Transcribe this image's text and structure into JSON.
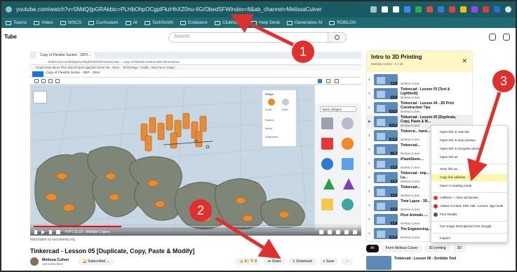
{
  "browser": {
    "url": "youtube.com/watch?v=5MdQ/jpGRAkbtc=PLHbOhpOCgplFkzHhXZ0nu-lIG/ObedSFWindex=8&ab_channel=MelissaCulver",
    "bookmarks": [
      "Teams",
      "Video",
      "WSCS",
      "Curriculum",
      "AI",
      "TechSmith",
      "Endeavor",
      "Clubhouse",
      "Help Desk",
      "Generative AI",
      "ROBLOX"
    ]
  },
  "masthead": {
    "logo": "Tube",
    "search_placeholder": "Search"
  },
  "video": {
    "inner_tab": "Copy of Flexible Socket - 3DPr...",
    "inner_url": "tinkercad.com/things/q-Ft8gFbXk/edit?sharecode=...copy-of-flexible-socket-with-dimensions",
    "inner_bookmarks": "Gmail  Drive  Menu  Plus 3dLCM Quiz  appointr  Home Ink - Nozo...  Technology - Usabl...  Best Hour Usage...",
    "design_title": "Copy of Flexible Socke - 3DP - 2024",
    "panel_title": "Shape",
    "panel_rows": [
      "Solid",
      "Hole",
      "Radius",
      "Bevel",
      "Segments"
    ],
    "category": "Basic Shapes",
    "watermark": "Watchable by wscsfamily.org",
    "time": "3:05 / 11:23 · Multiple Copies",
    "progress": 0.27
  },
  "below": {
    "title": "Tinkercad - Lesson 05 [Duplicate, Copy, Paste & Modify]",
    "channel": "Melissa Culver",
    "subscribers": "116 subscribers",
    "subscribe_label": "Subscribed",
    "likes": "9",
    "dislikes": "0",
    "share": "Share",
    "download": "Download",
    "save": "Save"
  },
  "playlist": {
    "title": "Intro to 3D Printing",
    "subtitle": "Melissa Culver - 6 / 25",
    "items": [
      {
        "title": "",
        "author": "Melissa Culver",
        "duration": "8:47"
      },
      {
        "title": "Tinkercad - Lesson 03 [Text & Lightbulb]",
        "author": "Melissa Culver",
        "duration": "9:12"
      },
      {
        "title": "Tinkercad - Lesson 04 - 3D Print Construction Tips",
        "author": "Melissa Culver",
        "duration": "12:34"
      },
      {
        "title": "Tinkercad - Lesson 05 [Duplicate, Copy, Paste & M...",
        "author": "Melissa Culver",
        "duration": "11:23"
      },
      {
        "title": "Tinkerca... hand...",
        "author": "Melissa Culver",
        "duration": "10:04"
      },
      {
        "title": "Tinkercad...",
        "author": "Melissa Culver",
        "duration": "7:58"
      },
      {
        "title": "iFlaskStone...",
        "author": "Melissa Culver",
        "duration": "6:41"
      },
      {
        "title": "Tinkercad - Imp... Scribble, and La...",
        "author": "Melissa Culver",
        "duration": "9:35"
      },
      {
        "title": "Tinkercad...",
        "author": "Melissa Culver",
        "duration": "5:22"
      },
      {
        "title": "Time Lapse - 3D... Prostitatic",
        "author": "Melissa Culver",
        "duration": "4:10"
      },
      {
        "title": "Flexi Animals -...",
        "author": "Melissa Culver",
        "duration": "3:47"
      },
      {
        "title": "The Engineering... Taco Party",
        "author": "Melissa Culver",
        "duration": "15:02"
      }
    ]
  },
  "chips": [
    "All",
    "From Melissa Culver",
    "3D printing",
    "3D"
  ],
  "next_video": "Tinkercad - Lesson 06 - Scribble Tool",
  "context_menu": {
    "items": [
      "Open link in new tab",
      "Open link in new window",
      "Open link in incognito window",
      "Open link as",
      "Save link as...",
      "Copy link address",
      "Open in reading mode",
      "AdBlock — best ad blocker",
      "Adobe Acrobat: PDF edit, convert, sign tools",
      "Font Details",
      "Get image descriptions from Google",
      "Inspect"
    ],
    "highlighted_index": 5
  },
  "annotations": {
    "markers": [
      "1",
      "2",
      "3"
    ],
    "arrow_color": "#e0302e"
  }
}
